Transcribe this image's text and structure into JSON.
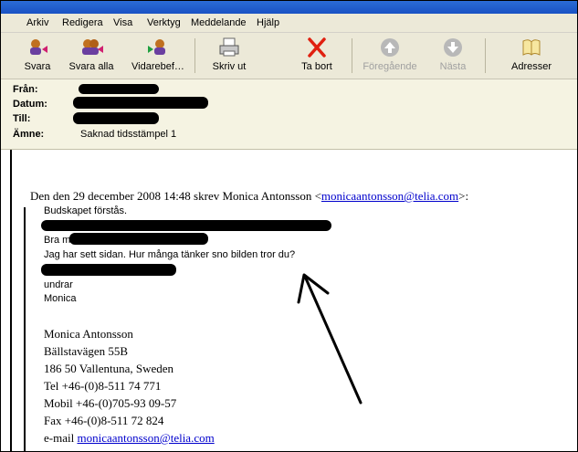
{
  "menu": [
    "Arkiv",
    "Redigera",
    "Visa",
    "Verktyg",
    "Meddelande",
    "Hjälp"
  ],
  "toolbar": {
    "buttons": [
      {
        "label": "Svara",
        "icon": "reply-icon",
        "enabled": true
      },
      {
        "label": "Svara alla",
        "icon": "reply-all-icon",
        "enabled": true
      },
      {
        "label": "Vidarebef…",
        "icon": "forward-icon",
        "enabled": true
      },
      {
        "label": "Skriv ut",
        "icon": "printer-icon",
        "enabled": true
      },
      {
        "label": "Ta bort",
        "icon": "delete-icon",
        "enabled": true
      },
      {
        "label": "Föregående",
        "icon": "previous-icon",
        "enabled": false
      },
      {
        "label": "Nästa",
        "icon": "next-icon",
        "enabled": false
      },
      {
        "label": "Adresser",
        "icon": "address-book-icon",
        "enabled": true
      }
    ]
  },
  "header": {
    "from_label": "Från:",
    "date_label": "Datum:",
    "to_label": "Till:",
    "subject_label": "Ämne:",
    "subject": "Saknad tidsstämpel 1"
  },
  "message": {
    "quote_intro_prefix": "Den den 29 december 2008 14:48 skrev Monica Antonsson <",
    "quote_intro_email": "monicaantonsson@telia.com",
    "quote_intro_suffix": ">:",
    "line1": "Budskapet förstås.",
    "line3_prefix": "Bra m",
    "line4": "Jag har sett sidan. Hur många tänker sno bilden tror du?",
    "line6": "undrar",
    "line7": "Monica",
    "sig_name": "Monica Antonsson",
    "sig_street": "Bällstavägen 55B",
    "sig_city": "186 50  Vallentuna, Sweden",
    "sig_tel": "Tel +46-(0)8-511 74 771",
    "sig_mobil": "Mobil +46-(0)705-93 09-57",
    "sig_fax": "Fax +46-(0)8-511 72 824",
    "sig_email_label": "e-mail",
    "sig_email": "monicaantonsson@telia.com"
  },
  "colors": {
    "titlebar": "#1a52c4",
    "chrome": "#ece9d8",
    "header_bg": "#f5f3e2",
    "link": "#0000cc"
  }
}
